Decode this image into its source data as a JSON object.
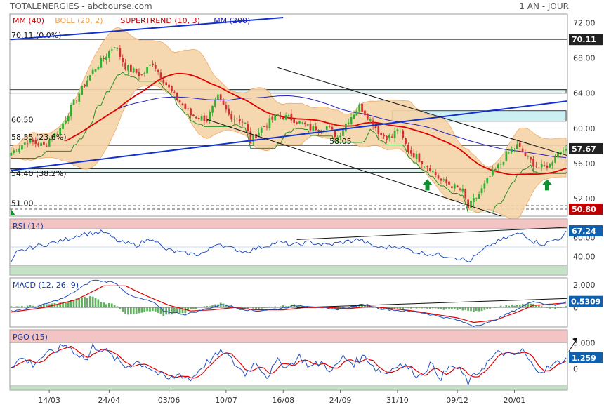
{
  "header": {
    "instrument": "TOTALENERGIES",
    "source": "abcbourse.com",
    "period": "1 AN - JOUR"
  },
  "legend": [
    {
      "label": "MM (40)",
      "color": "#e00000"
    },
    {
      "label": "BOLL (20, 2)",
      "color": "#f0a050"
    },
    {
      "label": "SUPERTREND (10, 3)",
      "color": "#c00000"
    },
    {
      "label": "MM (200)",
      "color": "#2020c0"
    }
  ],
  "colors": {
    "candle_up": "#30b030",
    "candle_down": "#d03030",
    "mm40": "#e00000",
    "mm200": "#2020c0",
    "supertrend": "#209020",
    "boll_fill": "#f6d4a8",
    "boll_line": "#eaa25a",
    "rsi_line": "#2050c0",
    "macd_line": "#2050c0",
    "signal_line": "#e00000",
    "hist": "#60b060",
    "pgo_line": "#2050c0",
    "pgo_avg": "#e00000",
    "zone_red": "#f2c4c4",
    "zone_green": "#c6e2c6",
    "badge_blue": "#1060b0",
    "badge_red": "#c00000",
    "trend_blue": "#1030d0"
  },
  "chart_data": [
    {
      "type": "candlestick",
      "panel": "price",
      "title": "TOTALENERGIES",
      "ylim": [
        50,
        73
      ],
      "y_ticks": [
        52,
        56,
        60,
        64,
        68,
        72
      ],
      "x_tick_labels": [
        "14/03",
        "24/04",
        "03/06",
        "10/07",
        "16/08",
        "24/09",
        "31/10",
        "09/12",
        "20/01"
      ],
      "x_tick_positions": [
        14,
        36,
        58,
        79,
        100,
        121,
        142,
        164,
        185
      ],
      "n_bars": 205,
      "close_anchors": [
        [
          0,
          57.2
        ],
        [
          6,
          58.6
        ],
        [
          12,
          58.0
        ],
        [
          18,
          60.0
        ],
        [
          24,
          63.5
        ],
        [
          30,
          66.5
        ],
        [
          34,
          68.0
        ],
        [
          38,
          69.5
        ],
        [
          42,
          67.0
        ],
        [
          48,
          66.0
        ],
        [
          52,
          67.5
        ],
        [
          58,
          64.5
        ],
        [
          62,
          63.0
        ],
        [
          66,
          61.5
        ],
        [
          72,
          61.0
        ],
        [
          76,
          63.5
        ],
        [
          80,
          61.5
        ],
        [
          84,
          61.0
        ],
        [
          86,
          60.5
        ],
        [
          88,
          58.5
        ],
        [
          92,
          60.0
        ],
        [
          98,
          61.5
        ],
        [
          104,
          61.0
        ],
        [
          110,
          60.0
        ],
        [
          116,
          60.2
        ],
        [
          120,
          59.0
        ],
        [
          124,
          61.0
        ],
        [
          128,
          62.5
        ],
        [
          132,
          61.0
        ],
        [
          136,
          59.2
        ],
        [
          140,
          59.0
        ],
        [
          142,
          60.0
        ],
        [
          146,
          57.5
        ],
        [
          150,
          56.5
        ],
        [
          154,
          55.5
        ],
        [
          158,
          54.0
        ],
        [
          162,
          53.5
        ],
        [
          166,
          52.8
        ],
        [
          168,
          51.0
        ],
        [
          172,
          52.5
        ],
        [
          176,
          54.5
        ],
        [
          180,
          56.0
        ],
        [
          182,
          57.0
        ],
        [
          186,
          58.0
        ],
        [
          190,
          56.5
        ],
        [
          194,
          55.5
        ],
        [
          198,
          55.8
        ],
        [
          200,
          57.0
        ],
        [
          204,
          58.0
        ]
      ],
      "last_close": 57.67,
      "badges": [
        {
          "value": "72.00",
          "kind": "tick"
        },
        {
          "value": "70.11",
          "kind": "level"
        },
        {
          "value": "57.67",
          "kind": "last"
        },
        {
          "value": "50.80",
          "kind": "support"
        }
      ],
      "annotations": [
        {
          "text": "70.11  (0.0%)",
          "y": 70.11
        },
        {
          "text": "60.50",
          "y": 60.5
        },
        {
          "text": "58.55  (23.6%)",
          "y": 58.55
        },
        {
          "text": "58.05",
          "y": 58.05
        },
        {
          "text": "54.40  (38.2%)",
          "y": 54.4
        },
        {
          "text": "51.00",
          "y": 51.0
        }
      ],
      "horizontal_levels": [
        70.11,
        64.4,
        64.0,
        60.5,
        58.05,
        55.4,
        55.0,
        51.2,
        50.8
      ],
      "rectangles": [
        {
          "x0": 77,
          "x1": 204,
          "y0": 64.0,
          "y1": 64.4,
          "fill": "#dff3f3"
        },
        {
          "x0": 140,
          "x1": 204,
          "y0": 60.8,
          "y1": 62.0,
          "fill": "#cdeef2"
        },
        {
          "x0": 0,
          "x1": 204,
          "y0": 55.0,
          "y1": 55.4,
          "fill": "#dff3f3"
        }
      ],
      "trendlines": [
        {
          "p0": [
            0,
            55.2
          ],
          "p1": [
            215,
            63.5
          ],
          "color": "#1030d0",
          "width": 2
        },
        {
          "p0": [
            0,
            70.1
          ],
          "p1": [
            100,
            72.6
          ],
          "color": "#1030d0",
          "width": 2
        },
        {
          "p0": [
            98,
            66.9
          ],
          "p1": [
            215,
            55.9
          ],
          "color": "#111111",
          "width": 1
        },
        {
          "p0": [
            72,
            61.0
          ],
          "p1": [
            190,
            49.0
          ],
          "color": "#111111",
          "width": 1
        }
      ],
      "arrows_up": [
        {
          "x": 153,
          "y": 54.2
        },
        {
          "x": 197,
          "y": 54.2
        }
      ]
    },
    {
      "type": "line",
      "panel": "rsi",
      "title": "RSI (14)",
      "ylim": [
        20,
        80
      ],
      "y_ticks": [
        40,
        60
      ],
      "zones": [
        {
          "from": 70,
          "to": 80,
          "color": "#f2c4c4"
        },
        {
          "from": 20,
          "to": 30,
          "color": "#c6e2c6"
        }
      ],
      "series": [
        {
          "name": "RSI (14)",
          "anchors": [
            [
              0,
              32
            ],
            [
              2,
              44
            ],
            [
              8,
              50
            ],
            [
              18,
              56
            ],
            [
              26,
              64
            ],
            [
              34,
              66
            ],
            [
              40,
              55
            ],
            [
              46,
              52
            ],
            [
              52,
              60
            ],
            [
              56,
              48
            ],
            [
              62,
              44
            ],
            [
              68,
              42
            ],
            [
              72,
              45
            ],
            [
              76,
              55
            ],
            [
              80,
              49
            ],
            [
              86,
              45
            ],
            [
              92,
              50
            ],
            [
              98,
              55
            ],
            [
              104,
              52
            ],
            [
              110,
              55
            ],
            [
              116,
              52
            ],
            [
              122,
              55
            ],
            [
              128,
              58
            ],
            [
              132,
              52
            ],
            [
              136,
              49
            ],
            [
              142,
              51
            ],
            [
              146,
              47
            ],
            [
              150,
              44
            ],
            [
              156,
              42
            ],
            [
              162,
              40
            ],
            [
              166,
              37
            ],
            [
              168,
              34
            ],
            [
              172,
              43
            ],
            [
              176,
              52
            ],
            [
              180,
              57
            ],
            [
              184,
              62
            ],
            [
              188,
              65
            ],
            [
              192,
              56
            ],
            [
              196,
              53
            ],
            [
              200,
              58
            ],
            [
              204,
              62
            ]
          ]
        }
      ],
      "last_value": 67.24,
      "trendline": {
        "p0": [
          105,
          58
        ],
        "p1": [
          215,
          71
        ]
      }
    },
    {
      "type": "line",
      "panel": "macd",
      "title": "MACD (12, 26, 9)",
      "ylim": [
        -1.7,
        2.6
      ],
      "y_ticks": [
        0,
        2.0
      ],
      "y_tick_labels": [
        "0",
        "2.000"
      ],
      "series": [
        {
          "name": "MACD",
          "anchors": [
            [
              0,
              -0.3
            ],
            [
              10,
              0.1
            ],
            [
              20,
              0.9
            ],
            [
              30,
              2.4
            ],
            [
              38,
              2.2
            ],
            [
              44,
              1.0
            ],
            [
              52,
              0.5
            ],
            [
              56,
              -0.3
            ],
            [
              64,
              -0.6
            ],
            [
              72,
              -0.1
            ],
            [
              78,
              0.3
            ],
            [
              84,
              -0.1
            ],
            [
              90,
              -0.3
            ],
            [
              98,
              -0.1
            ],
            [
              106,
              0.2
            ],
            [
              112,
              0.1
            ],
            [
              118,
              -0.2
            ],
            [
              124,
              0.0
            ],
            [
              130,
              0.3
            ],
            [
              136,
              -0.1
            ],
            [
              144,
              -0.3
            ],
            [
              150,
              -0.4
            ],
            [
              158,
              -0.8
            ],
            [
              164,
              -1.1
            ],
            [
              170,
              -1.6
            ],
            [
              176,
              -1.3
            ],
            [
              182,
              -0.6
            ],
            [
              188,
              0.1
            ],
            [
              192,
              0.6
            ],
            [
              196,
              0.3
            ],
            [
              200,
              0.2
            ],
            [
              204,
              0.5
            ]
          ]
        },
        {
          "name": "Signal",
          "anchors": [
            [
              0,
              -0.4
            ],
            [
              12,
              0.0
            ],
            [
              24,
              0.7
            ],
            [
              34,
              1.9
            ],
            [
              42,
              1.9
            ],
            [
              50,
              1.0
            ],
            [
              58,
              0.2
            ],
            [
              66,
              -0.3
            ],
            [
              74,
              -0.2
            ],
            [
              82,
              0.0
            ],
            [
              90,
              -0.2
            ],
            [
              100,
              -0.2
            ],
            [
              108,
              0.0
            ],
            [
              116,
              0.0
            ],
            [
              124,
              -0.1
            ],
            [
              132,
              0.1
            ],
            [
              140,
              -0.1
            ],
            [
              148,
              -0.3
            ],
            [
              156,
              -0.6
            ],
            [
              164,
              -0.9
            ],
            [
              170,
              -1.3
            ],
            [
              178,
              -1.1
            ],
            [
              186,
              -0.4
            ],
            [
              192,
              0.2
            ],
            [
              198,
              0.3
            ],
            [
              204,
              0.4
            ]
          ]
        }
      ],
      "last_value": 0.5309,
      "trendline": {
        "p0": [
          105,
          0.0
        ],
        "p1": [
          215,
          0.8
        ]
      }
    },
    {
      "type": "line",
      "panel": "pgo",
      "title": "PGO (15)",
      "ylim": [
        -2.5,
        4.5
      ],
      "y_ticks": [
        0,
        3.0
      ],
      "y_tick_labels": [
        "0",
        "3.000"
      ],
      "zones": [
        {
          "from": 3.0,
          "to": 4.5,
          "color": "#f2c4c4"
        },
        {
          "from": -2.5,
          "to": -2.0,
          "color": "#c6e2c6"
        }
      ],
      "series": [
        {
          "name": "PGO",
          "anchors": [
            [
              0,
              0.4
            ],
            [
              4,
              1.2
            ],
            [
              8,
              0.5
            ],
            [
              12,
              1.5
            ],
            [
              16,
              2.0
            ],
            [
              20,
              2.8
            ],
            [
              24,
              1.8
            ],
            [
              28,
              1.0
            ],
            [
              30,
              2.6
            ],
            [
              34,
              2.2
            ],
            [
              38,
              1.2
            ],
            [
              42,
              0.2
            ],
            [
              46,
              0.8
            ],
            [
              50,
              0.3
            ],
            [
              54,
              -0.6
            ],
            [
              58,
              -1.3
            ],
            [
              62,
              -0.6
            ],
            [
              66,
              -1.3
            ],
            [
              70,
              0.2
            ],
            [
              74,
              1.2
            ],
            [
              78,
              2.0
            ],
            [
              82,
              0.6
            ],
            [
              86,
              -0.6
            ],
            [
              90,
              0.8
            ],
            [
              94,
              -0.9
            ],
            [
              98,
              0.8
            ],
            [
              102,
              0.3
            ],
            [
              106,
              1.4
            ],
            [
              110,
              0.2
            ],
            [
              114,
              0.7
            ],
            [
              118,
              -0.3
            ],
            [
              122,
              1.3
            ],
            [
              126,
              0.6
            ],
            [
              130,
              1.5
            ],
            [
              134,
              0.0
            ],
            [
              138,
              -0.6
            ],
            [
              142,
              0.6
            ],
            [
              146,
              0.1
            ],
            [
              150,
              -0.9
            ],
            [
              154,
              0.5
            ],
            [
              158,
              -1.0
            ],
            [
              162,
              0.4
            ],
            [
              166,
              -0.6
            ],
            [
              168,
              -1.6
            ],
            [
              172,
              -0.3
            ],
            [
              176,
              1.0
            ],
            [
              180,
              2.0
            ],
            [
              184,
              1.4
            ],
            [
              188,
              2.1
            ],
            [
              192,
              0.1
            ],
            [
              196,
              -0.2
            ],
            [
              200,
              0.5
            ],
            [
              204,
              1.26
            ]
          ]
        }
      ],
      "last_value": 1.259
    }
  ]
}
